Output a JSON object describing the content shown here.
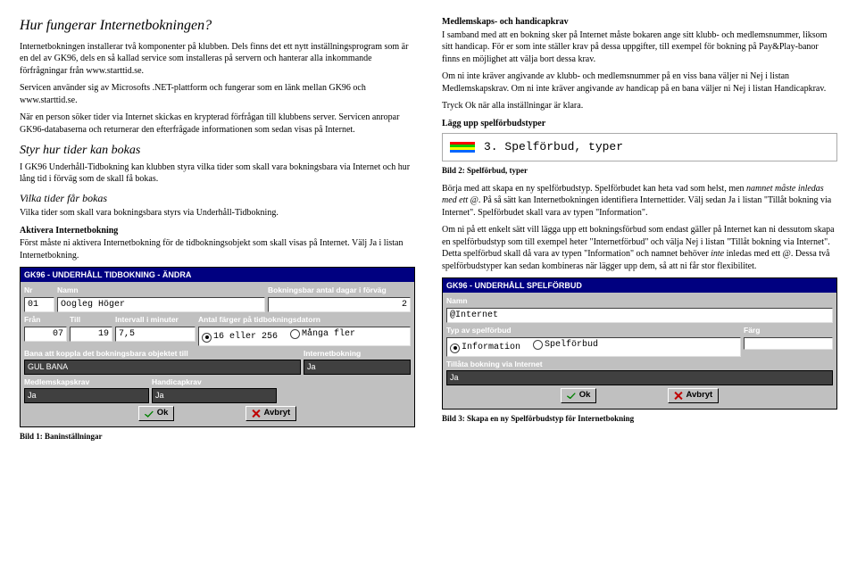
{
  "left": {
    "h1": "Hur fungerar Internetbokningen?",
    "p1": "Internetbokningen installerar två komponenter på klubben. Dels finns det ett nytt inställningsprogram som är en del av GK96, dels en så kallad service som installeras på servern och hanterar alla inkommande förfrågningar från www.starttid.se.",
    "p2": "Servicen använder sig av Microsofts .NET-plattform och fungerar som en länk mellan GK96 och www.starttid.se.",
    "p3": "När en person söker tider via Internet skickas en krypterad förfrågan till klubbens server. Servicen anropar GK96-databaserna och returnerar den efterfrågade informationen som sedan visas på Internet.",
    "h2": "Styr hur tider kan bokas",
    "p4": "I GK96 Underhåll-Tidbokning kan klubben styra vilka tider som skall vara bokningsbara via Internet och hur lång tid i förväg som de skall få bokas.",
    "h3": "Vilka tider får bokas",
    "p5": "Vilka tider som skall vara bokningsbara styrs via Underhåll-Tidbokning.",
    "bold1": "Aktivera Internetbokning",
    "p6": "Först måste ni aktivera Internetbokning för de tidbokningsobjekt som skall visas på Internet. Välj Ja i listan Internetbokning.",
    "caption1": "Bild 1: Baninställningar"
  },
  "right": {
    "bold1": "Medlemskaps- och handicapkrav",
    "p1": "I samband med att en bokning sker på Internet måste bokaren ange sitt klubb- och medlemsnummer, liksom sitt handicap. För er som inte ställer krav på dessa uppgifter, till exempel för bokning på Pay&Play-banor finns en möjlighet att välja bort dessa krav.",
    "p2": "Om ni inte kräver angivande av klubb- och medlemsnummer på en viss bana väljer ni Nej i listan Medlemskapskrav. Om ni inte kräver angivande av handicap på en bana väljer ni Nej i listan Handicapkrav.",
    "p3": "Tryck Ok när alla inställningar är klara.",
    "bold2": "Lägg upp spelförbudstyper",
    "spel_text": "3. Spelförbud, typer",
    "caption2": "Bild 2: Spelförbud, typer",
    "p4a": "Börja med att skapa en ny spelförbudstyp. Spelförbudet kan heta vad som helst, men ",
    "p4b": "namnet måste inledas med ett @",
    "p4c": ". På så sätt kan Internetbokningen identifiera Internettider. Välj sedan Ja i listan \"Tillåt bokning via Internet\". Spelförbudet skall vara av typen \"Information\".",
    "p5a": "Om ni på ett enkelt sätt vill lägga upp ett bokningsförbud som endast gäller på Internet kan ni dessutom skapa en spelförbudstyp som till exempel heter \"Internetförbud\" och välja Nej i listan \"Tillåt bokning via Internet\". Detta spelförbud skall då vara av typen \"Information\" och namnet behöver ",
    "p5b": "inte",
    "p5c": " inledas med ett @. Dessa två spelförbudstyper kan sedan kombineras när lägger upp dem, så att ni får stor flexibilitet.",
    "caption3": "Bild 3:  Skapa en ny Spelförbudstyp för Internetbokning"
  },
  "dlg1": {
    "title": "GK96 - UNDERHÅLL TIDBOKNING - ÄNDRA",
    "nr_lbl": "Nr",
    "nr_val": "01",
    "namn_lbl": "Namn",
    "namn_val": "Oogleg Höger",
    "dagar_lbl": "Bokningsbar antal dagar i förväg",
    "dagar_val": "2",
    "fran_lbl": "Från",
    "fran_val": "07",
    "till_lbl": "Till",
    "till_val": "19",
    "int_lbl": "Intervall i minuter",
    "int_val": "7,5",
    "farg_lbl": "Antal färger på tidbokningsdatorn",
    "r16": "16 eller 256",
    "rM": "Många fler",
    "bana_lbl": "Bana att koppla det bokningsbara objektet till",
    "bana_val": "GUL BANA",
    "inet_lbl": "Internetbokning",
    "inet_val": "Ja",
    "med_lbl": "Medlemskapskrav",
    "med_val": "Ja",
    "hcp_lbl": "Handicapkrav",
    "hcp_val": "Ja",
    "ok": "Ok",
    "avbryt": "Avbryt"
  },
  "dlg2": {
    "title": "GK96 - UNDERHÅLL SPELFÖRBUD",
    "namn_lbl": "Namn",
    "namn_val": "@Internet",
    "typ_lbl": "Typ av spelförbud",
    "r1": "Information",
    "r2": "Spelförbud",
    "farg_lbl": "Färg",
    "till_lbl": "Tillåta bokning via Internet",
    "till_val": "Ja",
    "ok": "Ok",
    "avbryt": "Avbryt"
  }
}
